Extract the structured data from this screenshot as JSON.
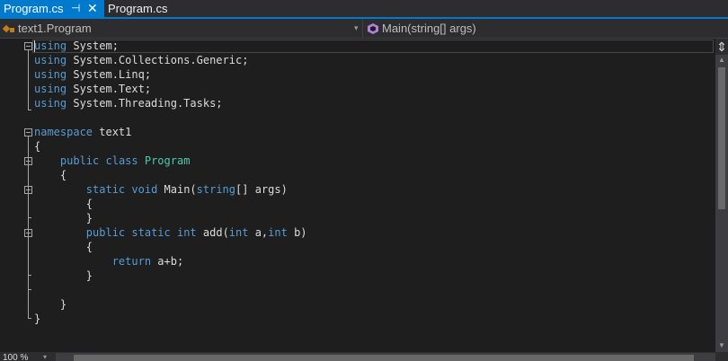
{
  "tabs": {
    "active": "Program.cs",
    "inactive": "Program.cs",
    "pin_glyph": "⊣",
    "close_glyph": "✕"
  },
  "navigation": {
    "class_selector": "text1.Program",
    "member_selector": "Main(string[] args)",
    "dropdown_glyph": "▾"
  },
  "code": {
    "lines": [
      [
        {
          "t": "using",
          "c": "kw"
        },
        {
          "t": " System;"
        }
      ],
      [
        {
          "t": "using",
          "c": "kw"
        },
        {
          "t": " System.Collections.Generic;"
        }
      ],
      [
        {
          "t": "using",
          "c": "kw"
        },
        {
          "t": " System.Linq;"
        }
      ],
      [
        {
          "t": "using",
          "c": "kw"
        },
        {
          "t": " System.Text;"
        }
      ],
      [
        {
          "t": "using",
          "c": "kw"
        },
        {
          "t": " System.Threading.Tasks;"
        }
      ],
      [],
      [
        {
          "t": "namespace",
          "c": "kw"
        },
        {
          "t": " text1"
        }
      ],
      [
        {
          "t": "{"
        }
      ],
      [
        {
          "t": "    "
        },
        {
          "t": "public",
          "c": "kw"
        },
        {
          "t": " "
        },
        {
          "t": "class",
          "c": "kw"
        },
        {
          "t": " "
        },
        {
          "t": "Program",
          "c": "ty"
        }
      ],
      [
        {
          "t": "    {"
        }
      ],
      [
        {
          "t": "        "
        },
        {
          "t": "static",
          "c": "kw"
        },
        {
          "t": " "
        },
        {
          "t": "void",
          "c": "kw"
        },
        {
          "t": " Main("
        },
        {
          "t": "string",
          "c": "kw"
        },
        {
          "t": "[] args)"
        }
      ],
      [
        {
          "t": "        {"
        }
      ],
      [
        {
          "t": "        }"
        }
      ],
      [
        {
          "t": "        "
        },
        {
          "t": "public",
          "c": "kw"
        },
        {
          "t": " "
        },
        {
          "t": "static",
          "c": "kw"
        },
        {
          "t": " "
        },
        {
          "t": "int",
          "c": "kw"
        },
        {
          "t": " add("
        },
        {
          "t": "int",
          "c": "kw"
        },
        {
          "t": " a,"
        },
        {
          "t": "int",
          "c": "kw"
        },
        {
          "t": " b)"
        }
      ],
      [
        {
          "t": "        {"
        }
      ],
      [
        {
          "t": "            "
        },
        {
          "t": "return",
          "c": "kw"
        },
        {
          "t": " a+b;"
        }
      ],
      [
        {
          "t": "        }"
        }
      ],
      [],
      [
        {
          "t": "    }"
        }
      ],
      [
        {
          "t": "}"
        }
      ]
    ]
  },
  "scrollbar": {
    "split_glyph": "⇕",
    "up_glyph": "▲",
    "down_glyph": "▼"
  },
  "statusbar": {
    "zoom": "100 %",
    "zoom_arrow": "▾"
  },
  "colors": {
    "accent": "#007acc",
    "keyword": "#569cd6",
    "type": "#4ec9b0",
    "text": "#dcdcdc",
    "background": "#1e1e1e"
  }
}
